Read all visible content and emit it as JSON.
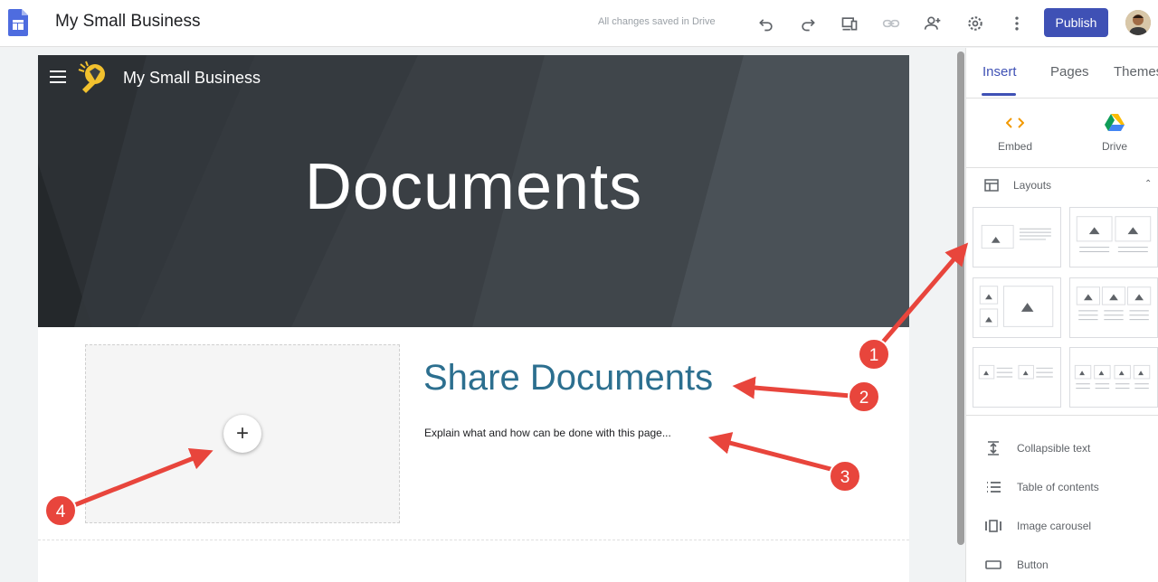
{
  "app": {
    "title": "My Small Business",
    "save_status": "All changes saved in Drive",
    "publish_label": "Publish"
  },
  "toolbar": {
    "icons": [
      "undo-icon",
      "redo-icon",
      "preview-icon",
      "link-icon",
      "share-icon",
      "settings-icon",
      "more-icon"
    ]
  },
  "site": {
    "name": "My Small Business",
    "hero_title": "Documents",
    "section_title": "Share Documents",
    "section_body": "Explain what and how  can be done with this page...",
    "add_label": "+"
  },
  "side_panel": {
    "tabs": [
      {
        "label": "Insert",
        "active": true
      },
      {
        "label": "Pages",
        "active": false
      },
      {
        "label": "Themes",
        "active": false
      }
    ],
    "insert_items": [
      {
        "label": "Embed",
        "icon": "embed-icon"
      },
      {
        "label": "Drive",
        "icon": "drive-icon"
      }
    ],
    "layouts_label": "Layouts",
    "menu_items": [
      {
        "label": "Collapsible text",
        "icon": "collapsible-text-icon"
      },
      {
        "label": "Table of contents",
        "icon": "toc-icon"
      },
      {
        "label": "Image carousel",
        "icon": "carousel-icon"
      },
      {
        "label": "Button",
        "icon": "button-icon"
      }
    ]
  },
  "annotations": {
    "markers": [
      "1",
      "2",
      "3",
      "4"
    ],
    "color": "#e8453c"
  },
  "colors": {
    "accent": "#3f51b5",
    "section_title": "#2c6f8f",
    "hero_bg": "#3a3f44"
  }
}
